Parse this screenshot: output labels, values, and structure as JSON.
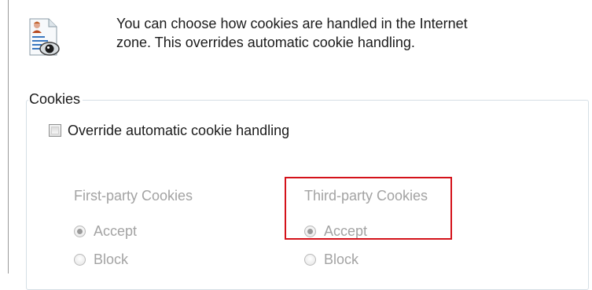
{
  "header": {
    "icon": "document-privacy-eye-icon",
    "intro_line1": "You can choose how cookies are handled in the Internet",
    "intro_line2": "zone.  This overrides automatic cookie handling."
  },
  "cookies_group": {
    "legend": "Cookies",
    "override_label": "Override automatic cookie handling",
    "override_checked": false
  },
  "first_party": {
    "heading": "First-party Cookies",
    "accept_label": "Accept",
    "block_label": "Block",
    "selected": "Accept"
  },
  "third_party": {
    "heading": "Third-party Cookies",
    "accept_label": "Accept",
    "block_label": "Block",
    "selected": "Accept"
  },
  "colors": {
    "highlight": "#d4121a",
    "disabled_text": "#a3a3a3"
  }
}
